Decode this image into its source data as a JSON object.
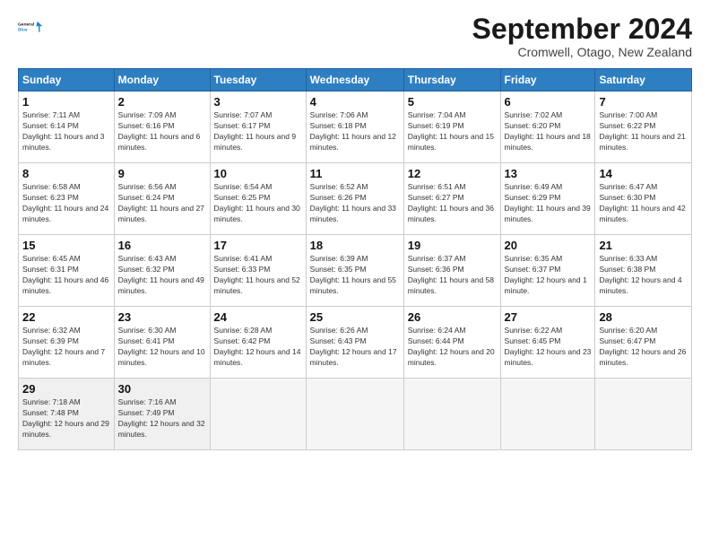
{
  "logo": {
    "line1": "General",
    "line2": "Blue"
  },
  "title": "September 2024",
  "location": "Cromwell, Otago, New Zealand",
  "days_of_week": [
    "Sunday",
    "Monday",
    "Tuesday",
    "Wednesday",
    "Thursday",
    "Friday",
    "Saturday"
  ],
  "weeks": [
    [
      {
        "day": "1",
        "sunrise": "Sunrise: 7:11 AM",
        "sunset": "Sunset: 6:14 PM",
        "daylight": "Daylight: 11 hours and 3 minutes."
      },
      {
        "day": "2",
        "sunrise": "Sunrise: 7:09 AM",
        "sunset": "Sunset: 6:16 PM",
        "daylight": "Daylight: 11 hours and 6 minutes."
      },
      {
        "day": "3",
        "sunrise": "Sunrise: 7:07 AM",
        "sunset": "Sunset: 6:17 PM",
        "daylight": "Daylight: 11 hours and 9 minutes."
      },
      {
        "day": "4",
        "sunrise": "Sunrise: 7:06 AM",
        "sunset": "Sunset: 6:18 PM",
        "daylight": "Daylight: 11 hours and 12 minutes."
      },
      {
        "day": "5",
        "sunrise": "Sunrise: 7:04 AM",
        "sunset": "Sunset: 6:19 PM",
        "daylight": "Daylight: 11 hours and 15 minutes."
      },
      {
        "day": "6",
        "sunrise": "Sunrise: 7:02 AM",
        "sunset": "Sunset: 6:20 PM",
        "daylight": "Daylight: 11 hours and 18 minutes."
      },
      {
        "day": "7",
        "sunrise": "Sunrise: 7:00 AM",
        "sunset": "Sunset: 6:22 PM",
        "daylight": "Daylight: 11 hours and 21 minutes."
      }
    ],
    [
      {
        "day": "8",
        "sunrise": "Sunrise: 6:58 AM",
        "sunset": "Sunset: 6:23 PM",
        "daylight": "Daylight: 11 hours and 24 minutes."
      },
      {
        "day": "9",
        "sunrise": "Sunrise: 6:56 AM",
        "sunset": "Sunset: 6:24 PM",
        "daylight": "Daylight: 11 hours and 27 minutes."
      },
      {
        "day": "10",
        "sunrise": "Sunrise: 6:54 AM",
        "sunset": "Sunset: 6:25 PM",
        "daylight": "Daylight: 11 hours and 30 minutes."
      },
      {
        "day": "11",
        "sunrise": "Sunrise: 6:52 AM",
        "sunset": "Sunset: 6:26 PM",
        "daylight": "Daylight: 11 hours and 33 minutes."
      },
      {
        "day": "12",
        "sunrise": "Sunrise: 6:51 AM",
        "sunset": "Sunset: 6:27 PM",
        "daylight": "Daylight: 11 hours and 36 minutes."
      },
      {
        "day": "13",
        "sunrise": "Sunrise: 6:49 AM",
        "sunset": "Sunset: 6:29 PM",
        "daylight": "Daylight: 11 hours and 39 minutes."
      },
      {
        "day": "14",
        "sunrise": "Sunrise: 6:47 AM",
        "sunset": "Sunset: 6:30 PM",
        "daylight": "Daylight: 11 hours and 42 minutes."
      }
    ],
    [
      {
        "day": "15",
        "sunrise": "Sunrise: 6:45 AM",
        "sunset": "Sunset: 6:31 PM",
        "daylight": "Daylight: 11 hours and 46 minutes."
      },
      {
        "day": "16",
        "sunrise": "Sunrise: 6:43 AM",
        "sunset": "Sunset: 6:32 PM",
        "daylight": "Daylight: 11 hours and 49 minutes."
      },
      {
        "day": "17",
        "sunrise": "Sunrise: 6:41 AM",
        "sunset": "Sunset: 6:33 PM",
        "daylight": "Daylight: 11 hours and 52 minutes."
      },
      {
        "day": "18",
        "sunrise": "Sunrise: 6:39 AM",
        "sunset": "Sunset: 6:35 PM",
        "daylight": "Daylight: 11 hours and 55 minutes."
      },
      {
        "day": "19",
        "sunrise": "Sunrise: 6:37 AM",
        "sunset": "Sunset: 6:36 PM",
        "daylight": "Daylight: 11 hours and 58 minutes."
      },
      {
        "day": "20",
        "sunrise": "Sunrise: 6:35 AM",
        "sunset": "Sunset: 6:37 PM",
        "daylight": "Daylight: 12 hours and 1 minute."
      },
      {
        "day": "21",
        "sunrise": "Sunrise: 6:33 AM",
        "sunset": "Sunset: 6:38 PM",
        "daylight": "Daylight: 12 hours and 4 minutes."
      }
    ],
    [
      {
        "day": "22",
        "sunrise": "Sunrise: 6:32 AM",
        "sunset": "Sunset: 6:39 PM",
        "daylight": "Daylight: 12 hours and 7 minutes."
      },
      {
        "day": "23",
        "sunrise": "Sunrise: 6:30 AM",
        "sunset": "Sunset: 6:41 PM",
        "daylight": "Daylight: 12 hours and 10 minutes."
      },
      {
        "day": "24",
        "sunrise": "Sunrise: 6:28 AM",
        "sunset": "Sunset: 6:42 PM",
        "daylight": "Daylight: 12 hours and 14 minutes."
      },
      {
        "day": "25",
        "sunrise": "Sunrise: 6:26 AM",
        "sunset": "Sunset: 6:43 PM",
        "daylight": "Daylight: 12 hours and 17 minutes."
      },
      {
        "day": "26",
        "sunrise": "Sunrise: 6:24 AM",
        "sunset": "Sunset: 6:44 PM",
        "daylight": "Daylight: 12 hours and 20 minutes."
      },
      {
        "day": "27",
        "sunrise": "Sunrise: 6:22 AM",
        "sunset": "Sunset: 6:45 PM",
        "daylight": "Daylight: 12 hours and 23 minutes."
      },
      {
        "day": "28",
        "sunrise": "Sunrise: 6:20 AM",
        "sunset": "Sunset: 6:47 PM",
        "daylight": "Daylight: 12 hours and 26 minutes."
      }
    ],
    [
      {
        "day": "29",
        "sunrise": "Sunrise: 7:18 AM",
        "sunset": "Sunset: 7:48 PM",
        "daylight": "Daylight: 12 hours and 29 minutes."
      },
      {
        "day": "30",
        "sunrise": "Sunrise: 7:16 AM",
        "sunset": "Sunset: 7:49 PM",
        "daylight": "Daylight: 12 hours and 32 minutes."
      },
      null,
      null,
      null,
      null,
      null
    ]
  ]
}
